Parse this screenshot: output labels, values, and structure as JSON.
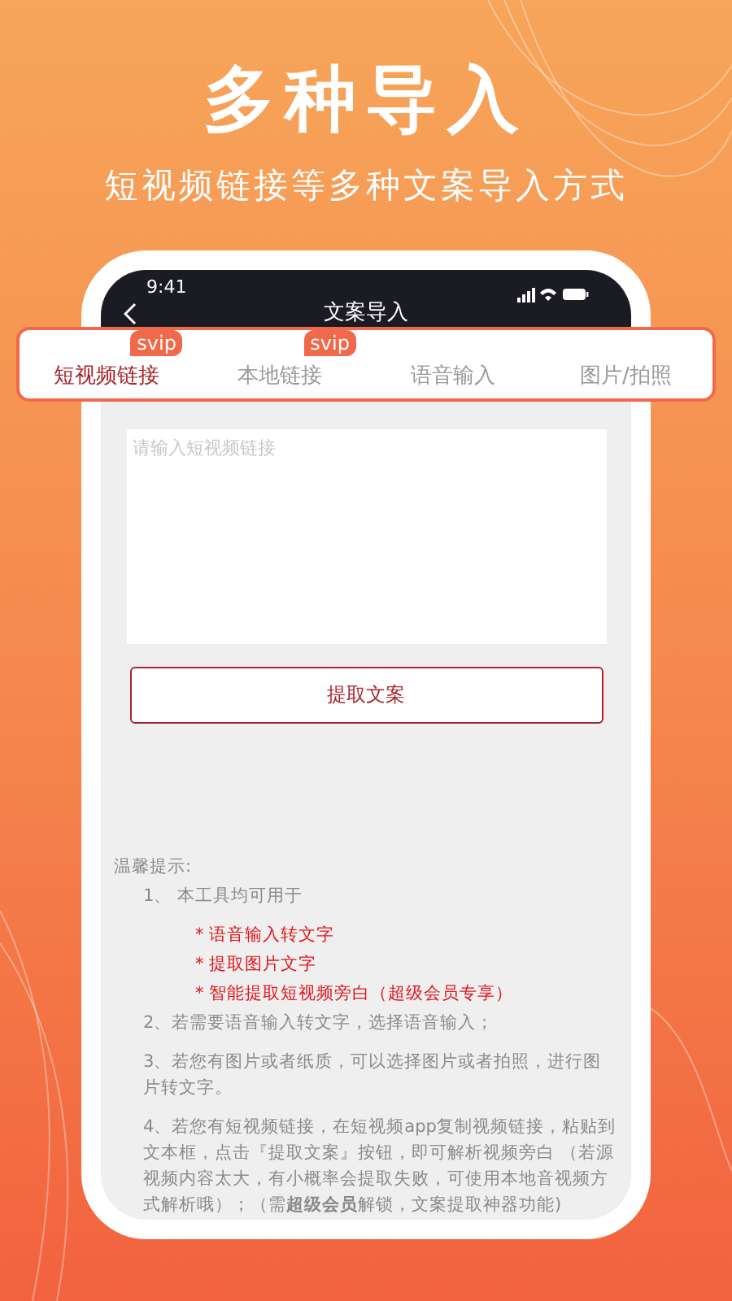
{
  "headline": "多种导入",
  "subheadline": "短视频链接等多种文案导入方式",
  "phone": {
    "time": "9:41",
    "title": "文案导入"
  },
  "tabs": [
    {
      "label": "短视频链接",
      "selected": true,
      "badge": "svip"
    },
    {
      "label": "本地链接",
      "selected": false,
      "badge": "svip"
    },
    {
      "label": "语音输入",
      "selected": false
    },
    {
      "label": "图片/拍照",
      "selected": false
    }
  ],
  "link_field": {
    "placeholder": "请输入短视频链接"
  },
  "extract_button": "提取文案",
  "tips": {
    "heading": "温馨提示:",
    "items": [
      {
        "text": "1、 本工具均可用于",
        "features": [
          "* 语音输入转文字",
          "* 提取图片文字",
          "* 智能提取短视频旁白（超级会员专享）"
        ]
      },
      {
        "text": "2、若需要语音输入转文字，选择语音输入；"
      },
      {
        "text": "3、若您有图片或者纸质，可以选择图片或者拍照，进行图片转文字。"
      },
      {
        "text": "4、若您有短视频链接，在短视频app复制视频链接，粘贴到文本框，点击『提取文案』按钮，即可解析视频旁白 （若源视频内容太大，有小概率会提取失败，可使用本地音视频方式解析哦）；（需**超级会员**解锁，文案提取神器功能)"
      }
    ]
  }
}
